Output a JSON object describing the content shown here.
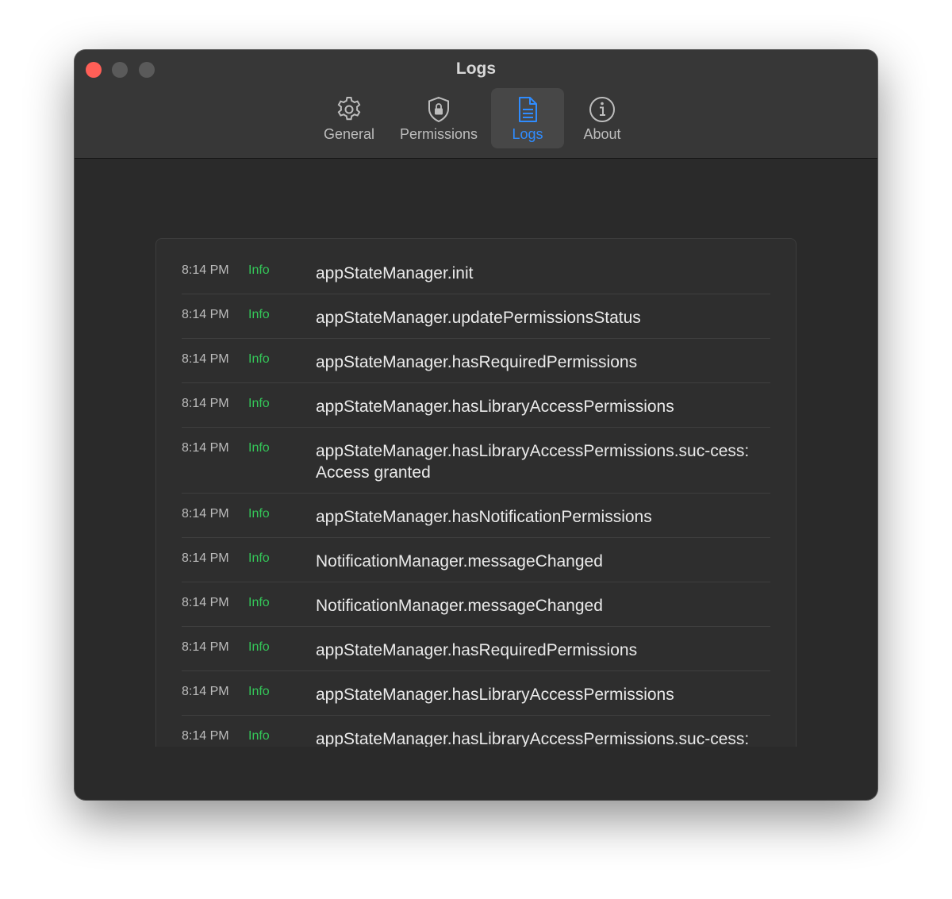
{
  "window": {
    "title": "Logs"
  },
  "toolbar": {
    "tabs": [
      {
        "label": "General",
        "icon": "gear-icon"
      },
      {
        "label": "Permissions",
        "icon": "shield-lock-icon"
      },
      {
        "label": "Logs",
        "icon": "document-icon",
        "selected": true
      },
      {
        "label": "About",
        "icon": "info-icon"
      }
    ]
  },
  "colors": {
    "accent": "#2f8cff",
    "info_level": "#34c759",
    "close_button": "#ff5f57"
  },
  "logs": [
    {
      "time": "8:14 PM",
      "level": "Info",
      "message": "appStateManager.init"
    },
    {
      "time": "8:14 PM",
      "level": "Info",
      "message": "appStateManager.updatePermissionsStatus"
    },
    {
      "time": "8:14 PM",
      "level": "Info",
      "message": "appStateManager.hasRequiredPermissions"
    },
    {
      "time": "8:14 PM",
      "level": "Info",
      "message": "appStateManager.hasLibraryAccessPermissions"
    },
    {
      "time": "8:14 PM",
      "level": "Info",
      "message": "appStateManager.hasLibraryAccessPermissions.suc-cess: Access granted"
    },
    {
      "time": "8:14 PM",
      "level": "Info",
      "message": "appStateManager.hasNotificationPermissions"
    },
    {
      "time": "8:14 PM",
      "level": "Info",
      "message": "NotificationManager.messageChanged"
    },
    {
      "time": "8:14 PM",
      "level": "Info",
      "message": "NotificationManager.messageChanged"
    },
    {
      "time": "8:14 PM",
      "level": "Info",
      "message": "appStateManager.hasRequiredPermissions"
    },
    {
      "time": "8:14 PM",
      "level": "Info",
      "message": "appStateManager.hasLibraryAccessPermissions"
    },
    {
      "time": "8:14 PM",
      "level": "Info",
      "message": "appStateManager.hasLibraryAccessPermissions.suc-cess: Access granted"
    }
  ]
}
